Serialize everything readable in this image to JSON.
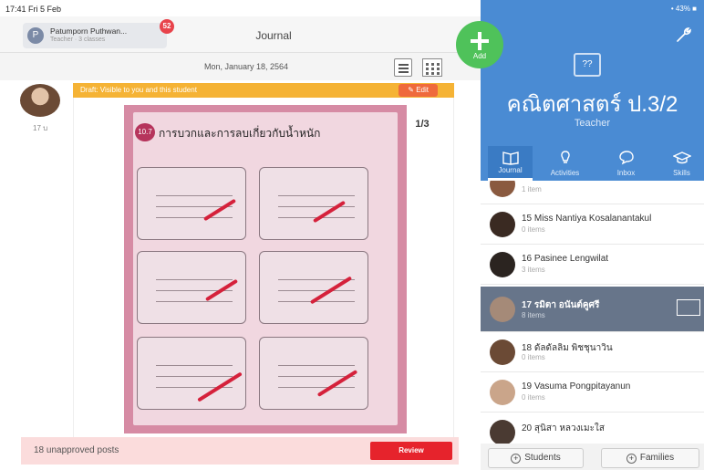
{
  "status": {
    "time": "17:41  Fri 5 Feb",
    "battery": "• 43% ■"
  },
  "header": {
    "teacher_name": "Patumporn Puthwan...",
    "teacher_sub": "Teacher · 3 classes",
    "avatar_letter": "P",
    "notif_count": "52",
    "title": "Journal"
  },
  "post": {
    "date": "Mon, January 18, 2564",
    "author_age": "17 บ",
    "draft_text": "Draft: Visible to you and this student",
    "edit_label": "Edit",
    "page_counter": "1/3",
    "worksheet_badge": "10.7",
    "worksheet_title": "การบวกและการลบเกี่ยวกับน้ำหนัก"
  },
  "unapproved": {
    "text": "18 unapproved posts",
    "review_label": "Review"
  },
  "add_button": {
    "label": "Add"
  },
  "class_panel": {
    "name": "คณิตศาสตร์ ป.3/2",
    "role": "Teacher",
    "icon_text": "??"
  },
  "tabs": [
    {
      "label": "Journal",
      "active": true
    },
    {
      "label": "Activities",
      "active": false
    },
    {
      "label": "Inbox",
      "active": false
    },
    {
      "label": "Skills",
      "active": false
    }
  ],
  "students": [
    {
      "name": "",
      "items": "1 item",
      "selected": false
    },
    {
      "name": "15 Miss Nantiya Kosalanantakul",
      "items": "0 items",
      "selected": false
    },
    {
      "name": "16 Pasinee Lengwilat",
      "items": "3 items",
      "selected": false
    },
    {
      "name": "17 รมิตา อนันต์คูศรี",
      "items": "8 items",
      "selected": true
    },
    {
      "name": "18 ดัลดัลลิม พิชชุนาวิน",
      "items": "0 items",
      "selected": false
    },
    {
      "name": "19 Vasuma Pongpitayanun",
      "items": "0 items",
      "selected": false
    },
    {
      "name": "20 สุนิสา หลวงเมะใส",
      "items": "",
      "selected": false
    }
  ],
  "bottom": {
    "students_label": "Students",
    "families_label": "Families"
  },
  "colors": {
    "accent": "#4a8bd3",
    "add": "#4fc25a",
    "draft": "#f5b335",
    "review": "#e6232c"
  }
}
